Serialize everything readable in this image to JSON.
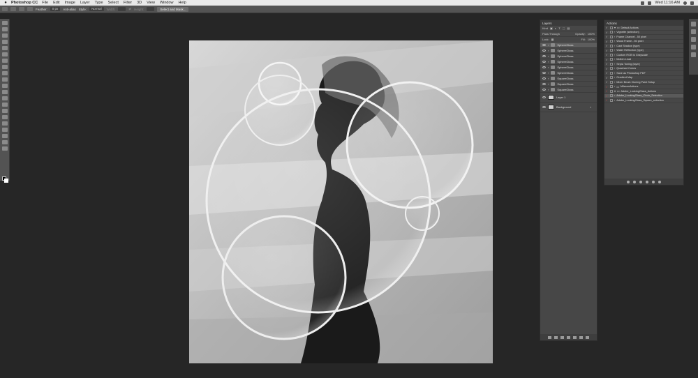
{
  "menubar": {
    "app": "Photoshop CC",
    "items": [
      "File",
      "Edit",
      "Image",
      "Layer",
      "Type",
      "Select",
      "Filter",
      "3D",
      "View",
      "Window",
      "Help"
    ],
    "clock": "Wed 11:16 AM"
  },
  "options": {
    "feather_label": "Feather:",
    "feather_value": "0 px",
    "antialias": "Anti-alias",
    "style_label": "Style:",
    "style_value": "Normal",
    "width_label": "Width:",
    "height_label": "Height:",
    "select_mask": "Select and Mask..."
  },
  "layers_panel": {
    "title": "Layers",
    "kind": "Kind",
    "blend_mode": "Pass Through",
    "opacity_label": "Opacity:",
    "opacity_value": "100%",
    "lock_label": "Lock:",
    "fill_label": "Fill:",
    "fill_value": "100%",
    "layers": [
      {
        "name": "SphereGlass",
        "type": "group"
      },
      {
        "name": "SphereGlass",
        "type": "group"
      },
      {
        "name": "SphereGlass",
        "type": "group"
      },
      {
        "name": "SphereGlass",
        "type": "group"
      },
      {
        "name": "SphereGlass",
        "type": "group"
      },
      {
        "name": "SphereGlass",
        "type": "group"
      },
      {
        "name": "SquareGlass",
        "type": "group"
      },
      {
        "name": "SquareGlass",
        "type": "group"
      },
      {
        "name": "SquareGlass",
        "type": "group"
      },
      {
        "name": "Layer 1",
        "type": "image"
      },
      {
        "name": "Background",
        "type": "image"
      }
    ]
  },
  "actions_panel": {
    "title": "Actions",
    "items": [
      "Default Actions",
      "Vignette (selection)",
      "Frame Channel - 50 pixel",
      "Wood Frame - 50 pixel",
      "Cast Shadow (type)",
      "Water Reflection (type)",
      "Custom RGB to Grayscale",
      "Molten Lead",
      "Sepia Toning (layer)",
      "Quadrant Colors",
      "Save as Photoshop PDF",
      "Gradient Map",
      "Mixer Brush Cloning Paint Setup",
      "MilesonActions",
      "Adobe_LookingGlass_Actions",
      "Adobe_LookingGlass_Circle_Selection",
      "Adobe_LookingGlass_Square_selection"
    ]
  },
  "colors": {
    "workspace": "#262626",
    "panel": "#474747",
    "menubar": "#e9e9e9"
  }
}
